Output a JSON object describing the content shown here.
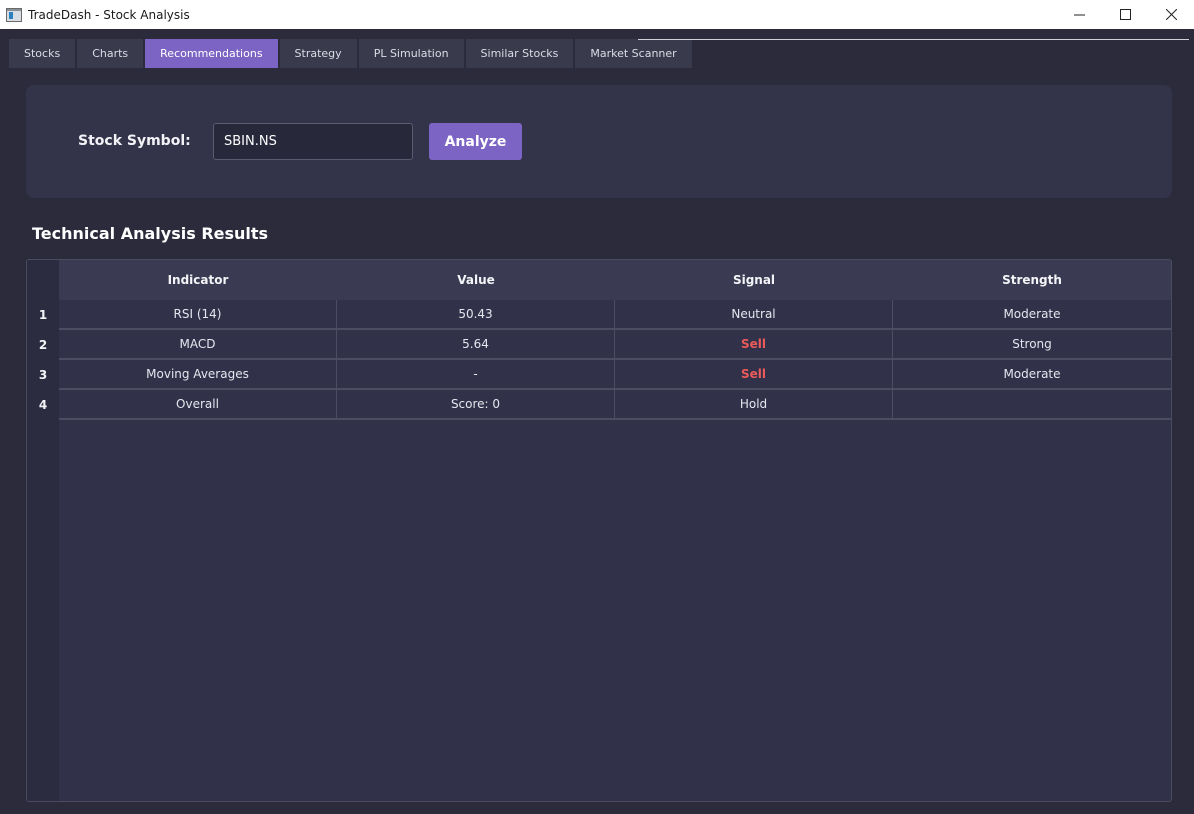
{
  "window": {
    "title": "TradeDash - Stock Analysis"
  },
  "tabs": [
    {
      "label": "Stocks",
      "active": false
    },
    {
      "label": "Charts",
      "active": false
    },
    {
      "label": "Recommendations",
      "active": true
    },
    {
      "label": "Strategy",
      "active": false
    },
    {
      "label": "PL Simulation",
      "active": false
    },
    {
      "label": "Similar Stocks",
      "active": false
    },
    {
      "label": "Market Scanner",
      "active": false
    }
  ],
  "form": {
    "symbol_label": "Stock Symbol:",
    "symbol_value": "SBIN.NS",
    "analyze_label": "Analyze"
  },
  "results": {
    "title": "Technical Analysis Results",
    "headers": [
      "Indicator",
      "Value",
      "Signal",
      "Strength"
    ],
    "rows": [
      {
        "num": "1",
        "indicator": "RSI (14)",
        "value": "50.43",
        "signal": "Neutral",
        "strength": "Moderate"
      },
      {
        "num": "2",
        "indicator": "MACD",
        "value": "5.64",
        "signal": "Sell",
        "strength": "Strong"
      },
      {
        "num": "3",
        "indicator": "Moving Averages",
        "value": "-",
        "signal": "Sell",
        "strength": "Moderate"
      },
      {
        "num": "4",
        "indicator": "Overall",
        "value": "Score: 0",
        "signal": "Hold",
        "strength": ""
      }
    ]
  },
  "colors": {
    "accent": "#7b64c3",
    "sell": "#ec5a5a",
    "background": "#2b2b3b"
  }
}
